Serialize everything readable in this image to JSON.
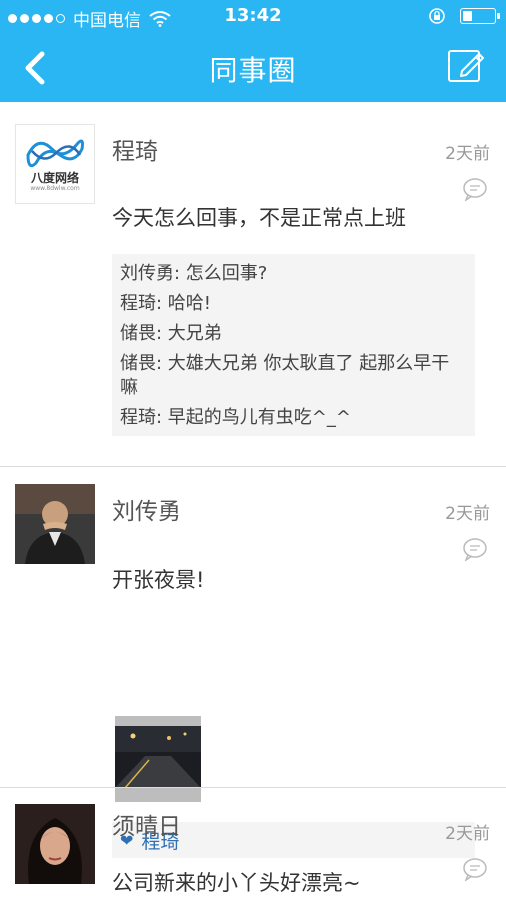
{
  "status_bar": {
    "carrier": "中国电信",
    "time": "13:42",
    "battery_level": 0.3
  },
  "nav": {
    "title": "同事圈",
    "back_icon": "back-icon",
    "compose_icon": "compose-icon"
  },
  "posts": [
    {
      "name": "程琦",
      "time": "2天前",
      "content": "今天怎么回事，不是正常点上班",
      "avatar_text": "八度网络",
      "avatar_subtext": "www.8dwlw.com",
      "comments": [
        "刘传勇: 怎么回事?",
        "程琦: 哈哈!",
        "储畏: 大兄弟",
        "储畏: 大雄大兄弟 你太耿直了  起那么早干嘛",
        "程琦: 早起的鸟儿有虫吃^_^"
      ]
    },
    {
      "name": "刘传勇",
      "time": "2天前",
      "content": "开张夜景!",
      "likes": [
        "程琦"
      ]
    },
    {
      "name": "须晴日",
      "time": "2天前",
      "content": "公司新来的小丫头好漂亮~"
    }
  ],
  "colors": {
    "accent": "#29b6f3",
    "like_blue": "#2f6fb3"
  }
}
